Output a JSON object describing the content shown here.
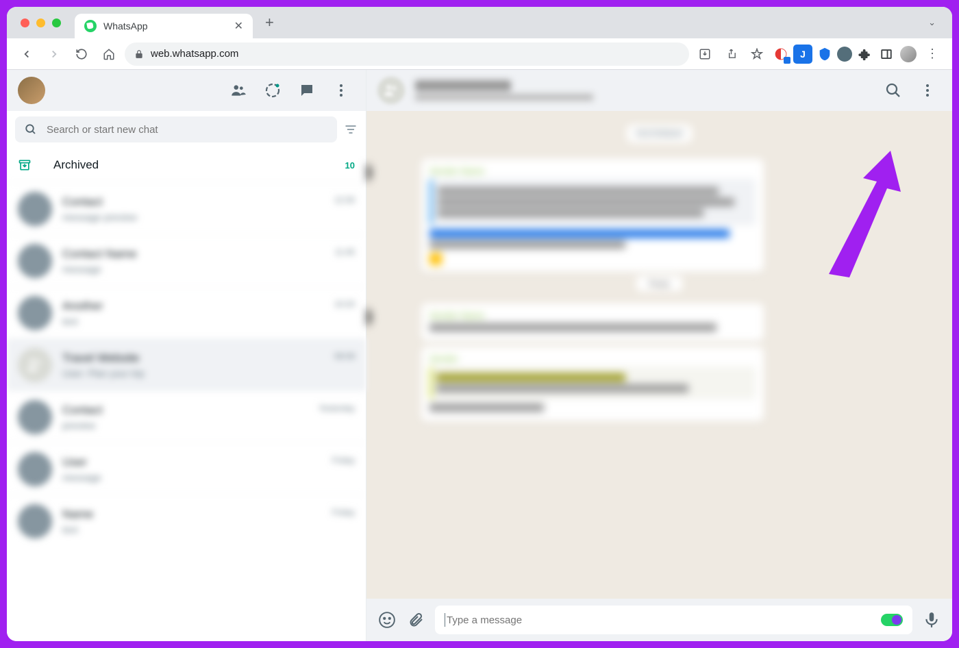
{
  "browser": {
    "tab_title": "WhatsApp",
    "url": "web.whatsapp.com"
  },
  "sidebar": {
    "search_placeholder": "Search or start new chat",
    "archived_label": "Archived",
    "archived_count": "10",
    "chats": [
      {
        "name": "Contact",
        "msg": "message preview",
        "time": "12:30"
      },
      {
        "name": "Contact Name",
        "msg": "message",
        "time": "11:45"
      },
      {
        "name": "Another",
        "msg": "text",
        "time": "10:20"
      },
      {
        "name": "Travel Website",
        "msg": "User: Plan your trip",
        "time": "08:08",
        "selected": true,
        "group": true
      },
      {
        "name": "Contact",
        "msg": "preview",
        "time": "Yesterday"
      },
      {
        "name": "User",
        "msg": "message",
        "time": "Friday"
      },
      {
        "name": "Name",
        "msg": "text",
        "time": "Friday"
      }
    ]
  },
  "chat": {
    "date_label": "YESTERDAY",
    "compose_placeholder": "Type a message"
  },
  "annotation": {
    "arrow_color": "#a020f0"
  }
}
